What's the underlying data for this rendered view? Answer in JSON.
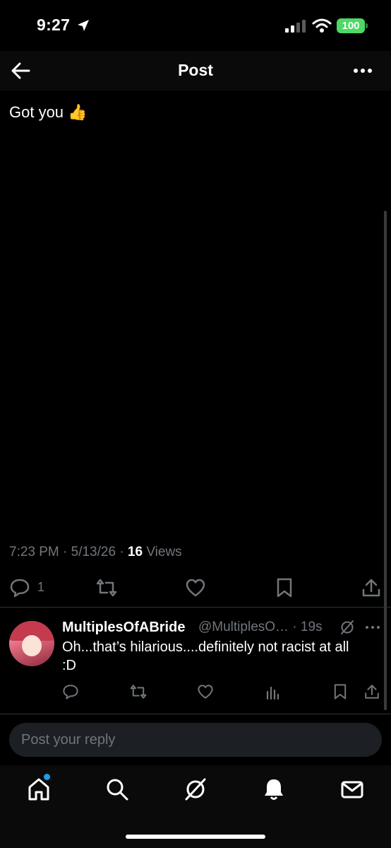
{
  "status_bar": {
    "time": "9:27",
    "battery": "100",
    "battery_color": "#4cd964"
  },
  "header": {
    "title": "Post"
  },
  "post": {
    "text": "Got you",
    "emoji": "👍",
    "timestamp": "7:23 PM · 5/13/26 · ",
    "views_count": "16",
    "views_label": " Views",
    "reply_count": "1"
  },
  "reply": {
    "name": "MultiplesOfABride",
    "handle": "@MultiplesO… · 19s",
    "body": "Oh...that’s hilarious....definitely not racist at all :D"
  },
  "composer": {
    "placeholder": "Post your reply"
  },
  "tabs": [
    "home-icon",
    "search-icon",
    "grok-icon",
    "notifications-icon",
    "messages-icon"
  ],
  "colors": {
    "accent": "#1d9bf0",
    "muted": "#71767b",
    "background": "#000000"
  }
}
